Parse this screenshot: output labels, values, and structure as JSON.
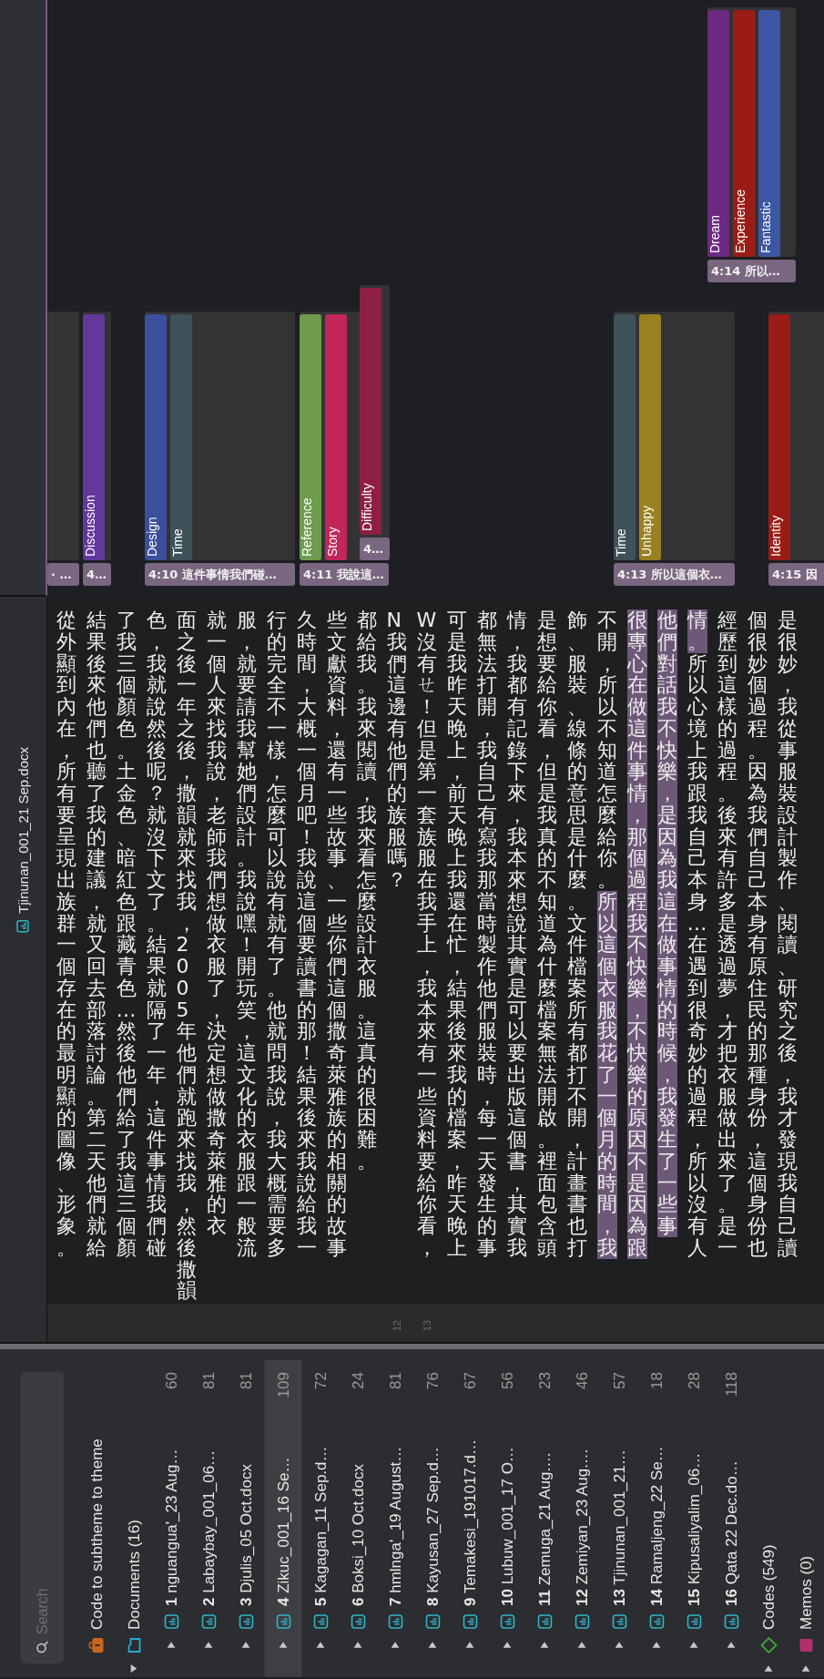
{
  "code_margin": {
    "segments": [
      {
        "chip": "· …"
      },
      {
        "chip": "4…",
        "codes": [
          {
            "label": "Discussion",
            "color": "#62389a"
          }
        ]
      },
      {
        "chip": "4:10 這件事情我們碰…",
        "codes": [
          {
            "label": "Design",
            "color": "#3b4f9c"
          },
          {
            "label": "Time",
            "color": "#3f5159"
          }
        ]
      },
      {
        "chip": "4…",
        "codes": [
          {
            "label": "Difficulty",
            "color": "#8e1f43"
          }
        ]
      },
      {
        "chip": "4:11 我說這…",
        "codes": [
          {
            "label": "Reference",
            "color": "#6f9b4d"
          },
          {
            "label": "Story",
            "color": "#c2275a"
          }
        ]
      },
      {
        "chip": "4:14 所以…",
        "codes": [
          {
            "label": "Dream",
            "color": "#6b2a80"
          },
          {
            "label": "Experience",
            "color": "#9b1c16"
          },
          {
            "label": "Fantastic",
            "color": "#3c56a3"
          }
        ]
      },
      {
        "chip": "4:13 所以這個衣…",
        "codes": [
          {
            "label": "Time",
            "color": "#3f5159"
          },
          {
            "label": "Unhappy",
            "color": "#9b8020"
          }
        ]
      },
      {
        "chip": "4:15 因",
        "codes": [
          {
            "label": "Identity",
            "color": "#9b1c16"
          }
        ]
      }
    ]
  },
  "document": {
    "title": "Tjinunan_001_21 Sep.docx",
    "lines": [
      {
        "segments": [
          {
            "text": "從外顯到內在，所有要呈現出族群一個存在的最明顯的圖像、形象。",
            "coded": false
          }
        ]
      },
      {
        "segments": [
          {
            "text": "結果後來他們也聽了我的建議，就又回去部落討論。第二天他們就給",
            "coded": false
          }
        ]
      },
      {
        "segments": [
          {
            "text": "了我三個顏色。土金色、暗紅色跟藏青色…然後他們給了我這三個顏",
            "coded": false
          }
        ]
      },
      {
        "segments": [
          {
            "text": "色，我就說然後呢？就沒下文了。結果就隔了一年，這件事情我們碰",
            "coded": false
          }
        ]
      },
      {
        "segments": [
          {
            "text": "面之後一年之後，撒韻就來找我，2005年他們就跑來找我，然後撒韻",
            "coded": false
          }
        ]
      },
      {
        "segments": [
          {
            "text": "就一個人來找我說，老師我們想做衣服了，決定想做撒奇萊雅的衣",
            "coded": false
          }
        ]
      },
      {
        "segments": [
          {
            "text": "服，就要請我幫她們設計。我說嘿！開玩笑，這文化的衣服跟一般流",
            "coded": false
          }
        ]
      },
      {
        "segments": [
          {
            "text": "行的完全不一樣，怎麼可以說有就有了。他就問我說，我大概需要多",
            "coded": false
          }
        ]
      },
      {
        "segments": [
          {
            "text": "久時間，大概一個月吧！我說這個要讀書的那！結果後來我說給我一",
            "coded": false
          }
        ]
      },
      {
        "segments": [
          {
            "text": "些文獻資料，還有一些故事、一些你們這個撒奇萊雅族的相關的故事",
            "coded": false
          }
        ]
      },
      {
        "segments": [
          {
            "text": "都給我。我來閱讀，我來看怎麼設計衣服。這真的很困難。",
            "coded": false
          }
        ]
      },
      {
        "number": "12",
        "segments": [
          {
            "text": "N 我們這邊有他們的族服嗎？",
            "coded": false
          }
        ]
      },
      {
        "number": "13",
        "segments": [
          {
            "text": "W 沒有ㄝ！但是第一套族服在我手上，我本來有一些資料要給你看，",
            "coded": false
          }
        ]
      },
      {
        "segments": [
          {
            "text": "可是我昨天晚上，前天晚上我還在忙，結果後來我的檔案，昨天晚上",
            "coded": false
          }
        ]
      },
      {
        "segments": [
          {
            "text": "都無法打開，我自己有寫我那當時製作他們服裝時，每一天發生的事",
            "coded": false
          }
        ]
      },
      {
        "segments": [
          {
            "text": "情，我都有記錄下來，我本來想說其實是可以要出版這個書，其實我",
            "coded": false
          }
        ]
      },
      {
        "segments": [
          {
            "text": "是想要給你看，但是我真的不知道為什麼檔案無法開啟。裡面包含頭",
            "coded": false
          }
        ]
      },
      {
        "segments": [
          {
            "text": "飾、服裝、線條的意思是什麼。文件檔案所有都打不開，計畫書也打",
            "coded": false
          }
        ]
      },
      {
        "segments": [
          {
            "text": "不開，所以不知道怎麼給你。",
            "coded": false
          },
          {
            "text": "所以這個衣服我花了一個月的時間，我",
            "coded": true
          }
        ]
      },
      {
        "segments": [
          {
            "text": "很專心在做這件事情，那個過程我不快樂，不快樂的原因不是因為跟",
            "coded": true
          }
        ]
      },
      {
        "segments": [
          {
            "text": "他們對話我不快樂，是因為我這在做事情的時候，我發生了一些事",
            "coded": true
          }
        ]
      },
      {
        "segments": [
          {
            "text": "情。",
            "coded": true
          },
          {
            "text": "所以心境上我跟我自己本身…在遇到很奇妙的過程，所以沒有人",
            "coded": false
          }
        ]
      },
      {
        "segments": [
          {
            "text": "經歷到這樣的過程。後來有許多是透過夢，才把衣服做出來了。是一",
            "coded": false
          }
        ]
      },
      {
        "segments": [
          {
            "text": "個很妙個過程。因為我們自己本身有原住民的那種身份，這個身份也",
            "coded": false
          }
        ]
      },
      {
        "segments": [
          {
            "text": "是很妙，我從事服裝設計製作、閱讀、研究之後，我才發現我自己讀",
            "coded": false
          }
        ]
      }
    ]
  },
  "sidebar": {
    "search": {
      "placeholder": "Search"
    },
    "items": [
      {
        "kind": "set",
        "label": "Code to subtheme to theme"
      },
      {
        "kind": "folder",
        "label": "Documents (16)",
        "expanded": true,
        "children": [
          {
            "number": "1",
            "name": "nguangua'_23 Aug…",
            "count": "60",
            "expanded": false,
            "selected": false
          },
          {
            "number": "2",
            "name": "Labaybay_001_06…",
            "count": "81",
            "expanded": false,
            "selected": false
          },
          {
            "number": "3",
            "name": "Djulis_05 Oct.docx",
            "count": "81",
            "expanded": false,
            "selected": false
          },
          {
            "number": "4",
            "name": "Zikuc_001_16 Se…",
            "count": "109",
            "expanded": false,
            "selected": true
          },
          {
            "number": "5",
            "name": "Kagagan_11 Sep.d…",
            "count": "72",
            "expanded": false,
            "selected": false
          },
          {
            "number": "6",
            "name": "Boksi_10 Oct.docx",
            "count": "24",
            "expanded": false,
            "selected": false
          },
          {
            "number": "7",
            "name": "hmlnga'_19 August…",
            "count": "81",
            "expanded": false,
            "selected": false
          },
          {
            "number": "8",
            "name": "Kayusan_27 Sep.d…",
            "count": "76",
            "expanded": false,
            "selected": false
          },
          {
            "number": "9",
            "name": "Temakesi_191017.d…",
            "count": "67",
            "expanded": false,
            "selected": false
          },
          {
            "number": "10",
            "name": "Lubuw_001_17 O…",
            "count": "56",
            "expanded": false,
            "selected": false
          },
          {
            "number": "11",
            "name": "Zemuga_21 Aug.…",
            "count": "23",
            "expanded": false,
            "selected": false
          },
          {
            "number": "12",
            "name": "Zemiyan_23 Aug.…",
            "count": "46",
            "expanded": false,
            "selected": false
          },
          {
            "number": "13",
            "name": "Tjinunan_001_21…",
            "count": "57",
            "expanded": false,
            "selected": false
          },
          {
            "number": "14",
            "name": "Ramaljeng_22 Se…",
            "count": "18",
            "expanded": false,
            "selected": false
          },
          {
            "number": "15",
            "name": "Kipusaliyalim_06…",
            "count": "28",
            "expanded": false,
            "selected": false
          },
          {
            "number": "16",
            "name": "Qata 22 Dec.do…",
            "count": "118",
            "expanded": false,
            "selected": false
          }
        ]
      },
      {
        "kind": "codes",
        "label": "Codes (549)",
        "expanded": false
      },
      {
        "kind": "memos",
        "label": "Memos (0)",
        "expanded": false
      }
    ]
  }
}
